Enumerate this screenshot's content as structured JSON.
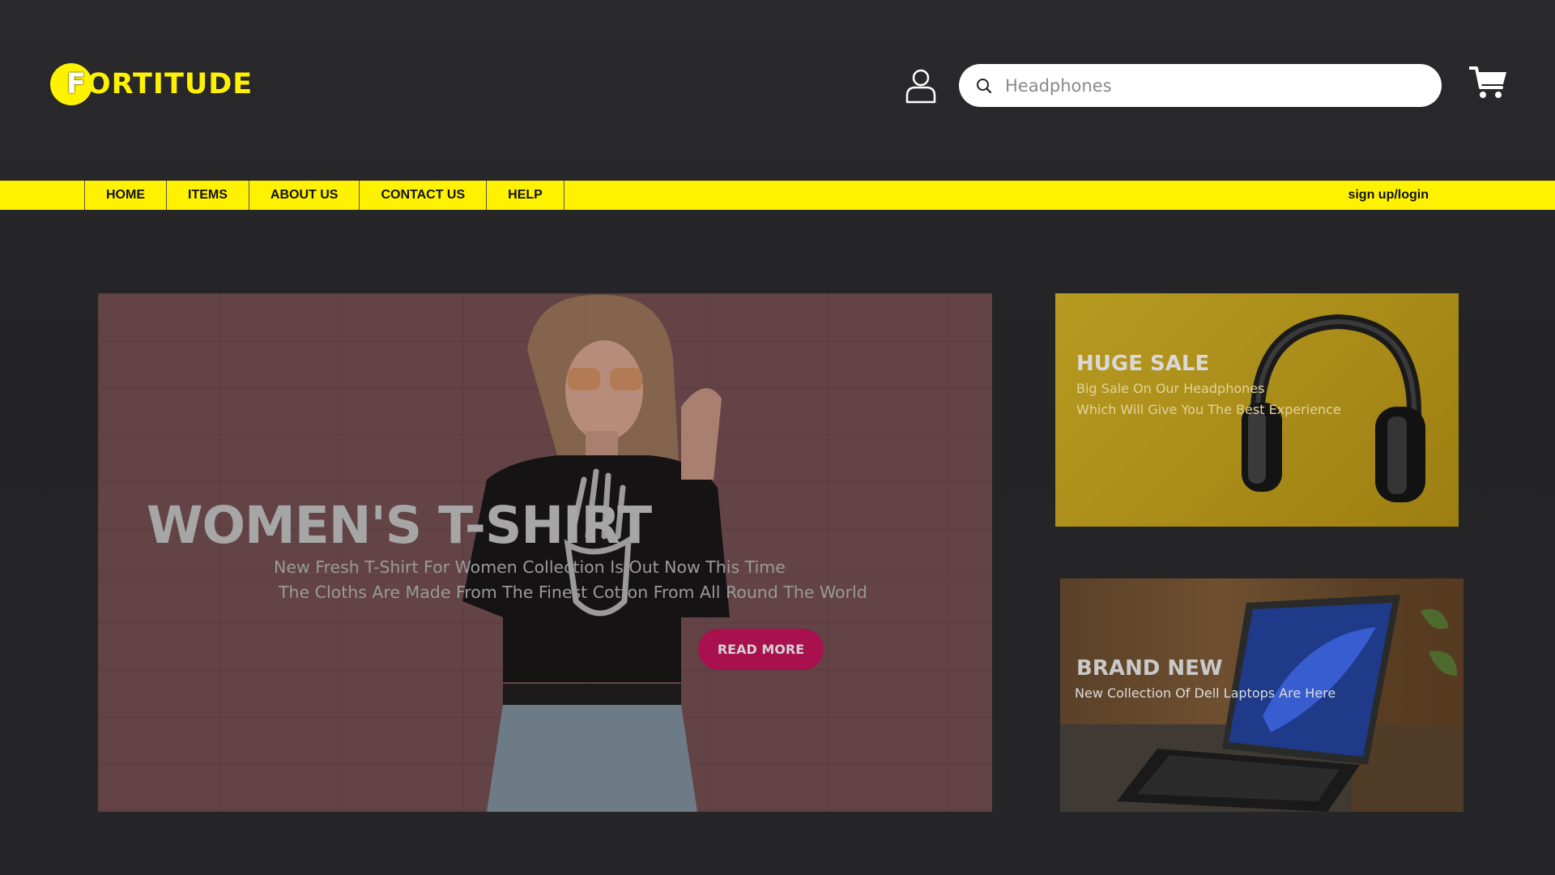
{
  "brand": {
    "logo_text": "FORTITUDE",
    "accent": "#fff200"
  },
  "header": {
    "search": {
      "placeholder": "Headphones",
      "value": ""
    },
    "icons": [
      "user-icon",
      "search-icon",
      "cart-icon"
    ]
  },
  "nav": {
    "items": [
      {
        "label": "HOME"
      },
      {
        "label": "ITEMS"
      },
      {
        "label": "ABOUT US"
      },
      {
        "label": "CONTACT US"
      },
      {
        "label": "HELP"
      }
    ],
    "signup": "sign up/login"
  },
  "hero": {
    "title": "WOMEN'S T-SHIRT",
    "line1": "New Fresh T-Shirt For Women Collection Is Out Now This Time",
    "line2": "The Cloths Are Made From The Finest Cotton From All Round The World",
    "button": "READ MORE",
    "button_color": "#a8104e"
  },
  "promos": {
    "sale": {
      "title": "HUGE SALE",
      "line1": "Big Sale On Our Headphones",
      "line2": "Which Will Give You The Best Experience"
    },
    "new": {
      "title": "BRAND NEW",
      "line1": "New Collection Of Dell Laptops Are Here"
    }
  }
}
